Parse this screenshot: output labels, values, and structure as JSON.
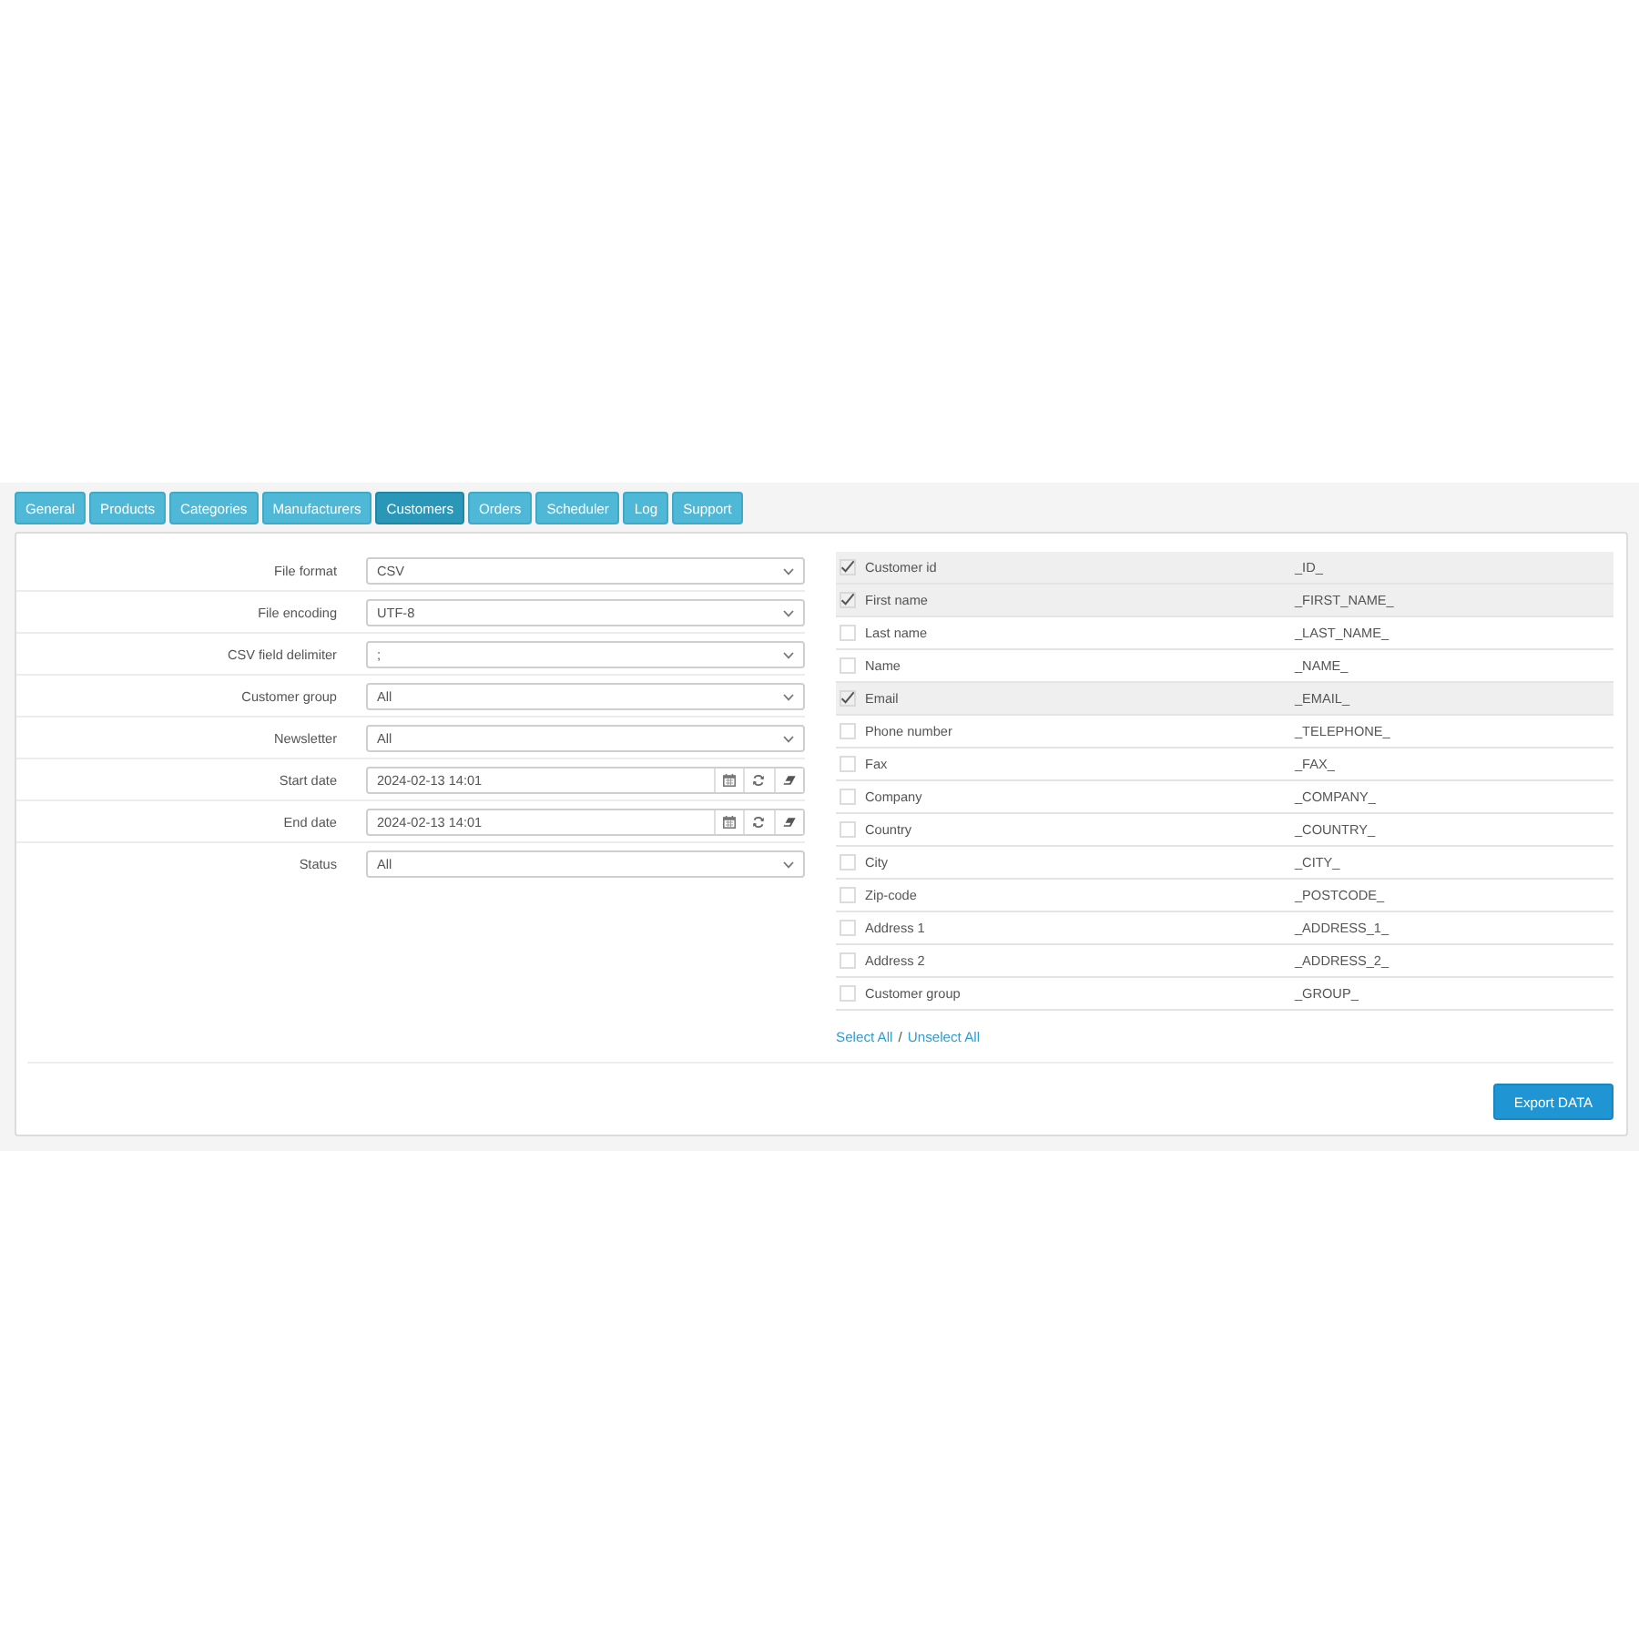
{
  "tabs": [
    {
      "label": "General",
      "selected": false
    },
    {
      "label": "Products",
      "selected": false
    },
    {
      "label": "Categories",
      "selected": false
    },
    {
      "label": "Manufacturers",
      "selected": false
    },
    {
      "label": "Customers",
      "selected": true
    },
    {
      "label": "Orders",
      "selected": false
    },
    {
      "label": "Scheduler",
      "selected": false
    },
    {
      "label": "Log",
      "selected": false
    },
    {
      "label": "Support",
      "selected": false
    }
  ],
  "settings": [
    {
      "label": "File format",
      "kind": "select",
      "value": "CSV"
    },
    {
      "label": "File encoding",
      "kind": "select",
      "value": "UTF-8"
    },
    {
      "label": "CSV field delimiter",
      "kind": "select",
      "value": ";"
    },
    {
      "label": "Customer group",
      "kind": "select",
      "value": "All"
    },
    {
      "label": "Newsletter",
      "kind": "select",
      "value": "All"
    },
    {
      "label": "Start date",
      "kind": "date",
      "value": "2024-02-13 14:01"
    },
    {
      "label": "End date",
      "kind": "date",
      "value": "2024-02-13 14:01"
    },
    {
      "label": "Status",
      "kind": "select",
      "value": "All"
    }
  ],
  "fields": [
    {
      "label": "Customer id",
      "code": "_ID_",
      "checked": true
    },
    {
      "label": "First name",
      "code": "_FIRST_NAME_",
      "checked": true
    },
    {
      "label": "Last name",
      "code": "_LAST_NAME_",
      "checked": false
    },
    {
      "label": "Name",
      "code": "_NAME_",
      "checked": false
    },
    {
      "label": "Email",
      "code": "_EMAIL_",
      "checked": true
    },
    {
      "label": "Phone number",
      "code": "_TELEPHONE_",
      "checked": false
    },
    {
      "label": "Fax",
      "code": "_FAX_",
      "checked": false
    },
    {
      "label": "Company",
      "code": "_COMPANY_",
      "checked": false
    },
    {
      "label": "Country",
      "code": "_COUNTRY_",
      "checked": false
    },
    {
      "label": "City",
      "code": "_CITY_",
      "checked": false
    },
    {
      "label": "Zip-code",
      "code": "_POSTCODE_",
      "checked": false
    },
    {
      "label": "Address 1",
      "code": "_ADDRESS_1_",
      "checked": false
    },
    {
      "label": "Address 2",
      "code": "_ADDRESS_2_",
      "checked": false
    },
    {
      "label": "Customer group",
      "code": "_GROUP_",
      "checked": false
    }
  ],
  "select_all": "Select All",
  "separator": "/",
  "unselect_all": "Unselect All",
  "export_button": "Export DATA"
}
